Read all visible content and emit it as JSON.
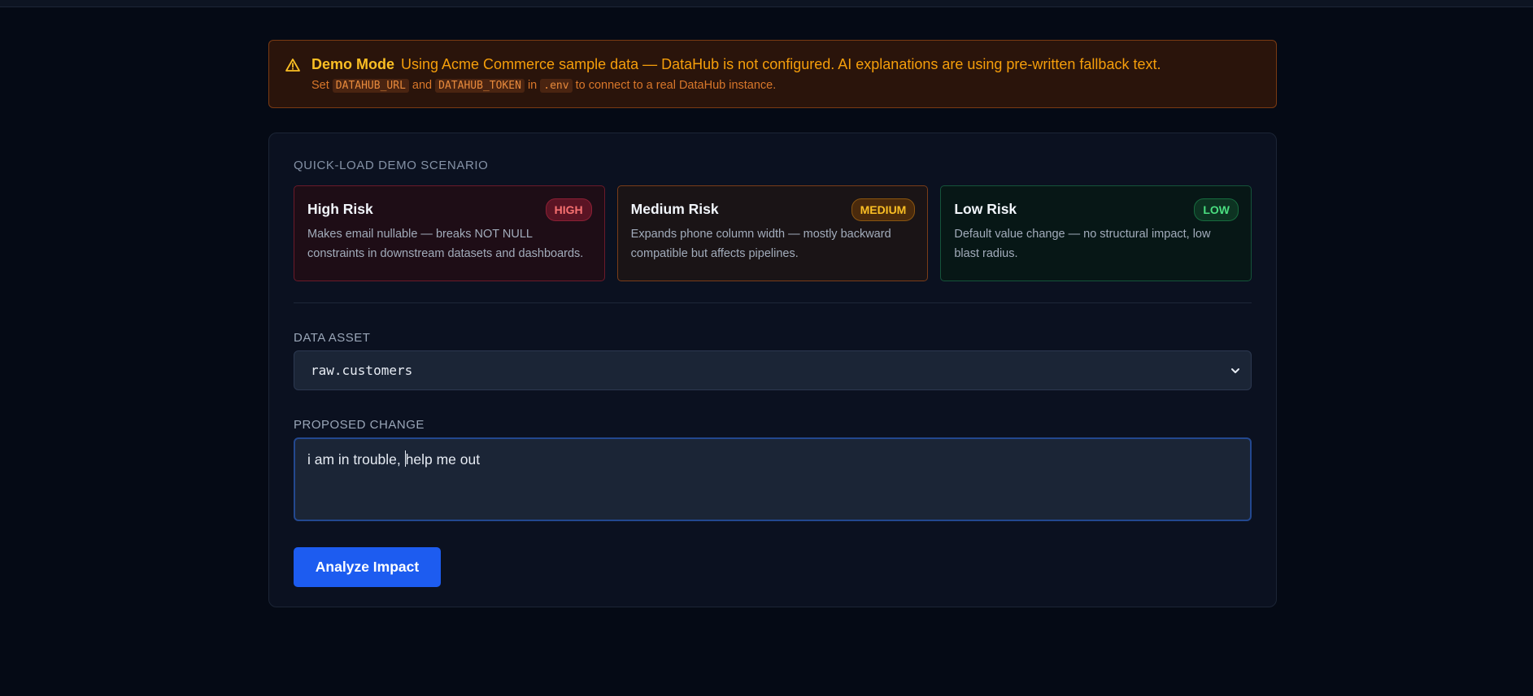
{
  "banner": {
    "title": "Demo Mode",
    "message": "Using Acme Commerce sample data — DataHub is not configured. AI explanations are using pre-written fallback text.",
    "hint_set": "Set",
    "code_url": "DATAHUB_URL",
    "hint_and": "and",
    "code_token": "DATAHUB_TOKEN",
    "hint_in": "in",
    "code_env": ".env",
    "hint_tail": "to connect to a real DataHub instance."
  },
  "scenarios": {
    "label": "QUICK-LOAD DEMO SCENARIO",
    "items": [
      {
        "title": "High Risk",
        "badge": "HIGH",
        "description": "Makes email nullable — breaks NOT NULL constraints in downstream datasets and dashboards."
      },
      {
        "title": "Medium Risk",
        "badge": "MEDIUM",
        "description": "Expands phone column width — mostly backward compatible but affects pipelines."
      },
      {
        "title": "Low Risk",
        "badge": "LOW",
        "description": "Default value change — no structural impact, low blast radius."
      }
    ]
  },
  "form": {
    "asset_label": "DATA ASSET",
    "asset_value": "raw.customers",
    "change_label": "PROPOSED CHANGE",
    "change_before_caret": "i am in trouble, ",
    "change_after_caret": "help me out",
    "submit_label": "Analyze Impact"
  },
  "colors": {
    "background": "#050a15",
    "accent": "#1d5cf0",
    "high": "#f87171",
    "medium": "#fbbf24",
    "low": "#4ade80"
  },
  "icons": [
    "warning-icon",
    "chevron-down-icon"
  ]
}
